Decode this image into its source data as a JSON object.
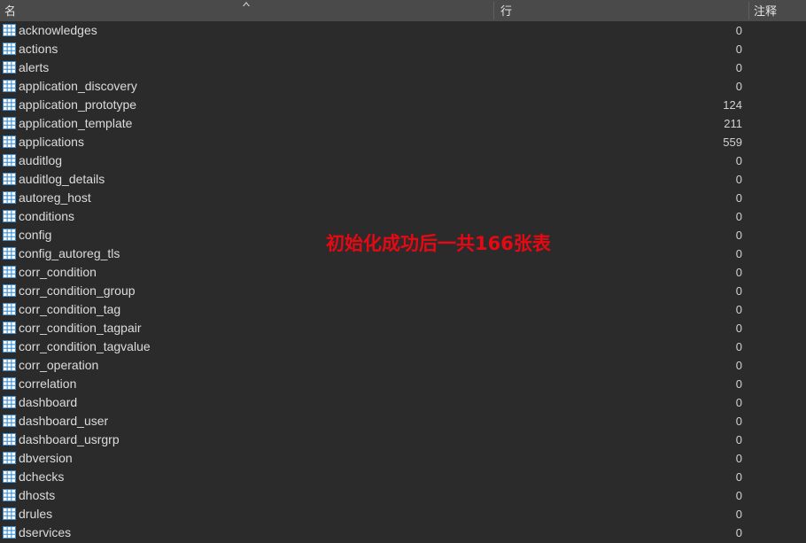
{
  "header": {
    "columns": [
      {
        "key": "name",
        "label": "名"
      },
      {
        "key": "rows",
        "label": "行"
      },
      {
        "key": "comment",
        "label": "注释"
      }
    ],
    "sort": {
      "column": "name",
      "direction": "ascending",
      "icon": "caret-up-icon"
    }
  },
  "annotation": {
    "text": "初始化成功后一共166张表",
    "color": "#e50914"
  },
  "colors": {
    "header_background": "#4a4a4a",
    "body_background": "#2b2b2b",
    "text": "#dcdcdc",
    "table_icon": "#3d8fd1",
    "annotation_red": "#e50914"
  },
  "table_list": {
    "row_icon": "table-icon",
    "rows": [
      {
        "name": "acknowledges",
        "rows": "0",
        "comment": ""
      },
      {
        "name": "actions",
        "rows": "0",
        "comment": ""
      },
      {
        "name": "alerts",
        "rows": "0",
        "comment": ""
      },
      {
        "name": "application_discovery",
        "rows": "0",
        "comment": ""
      },
      {
        "name": "application_prototype",
        "rows": "124",
        "comment": ""
      },
      {
        "name": "application_template",
        "rows": "211",
        "comment": ""
      },
      {
        "name": "applications",
        "rows": "559",
        "comment": ""
      },
      {
        "name": "auditlog",
        "rows": "0",
        "comment": ""
      },
      {
        "name": "auditlog_details",
        "rows": "0",
        "comment": ""
      },
      {
        "name": "autoreg_host",
        "rows": "0",
        "comment": ""
      },
      {
        "name": "conditions",
        "rows": "0",
        "comment": ""
      },
      {
        "name": "config",
        "rows": "0",
        "comment": ""
      },
      {
        "name": "config_autoreg_tls",
        "rows": "0",
        "comment": ""
      },
      {
        "name": "corr_condition",
        "rows": "0",
        "comment": ""
      },
      {
        "name": "corr_condition_group",
        "rows": "0",
        "comment": ""
      },
      {
        "name": "corr_condition_tag",
        "rows": "0",
        "comment": ""
      },
      {
        "name": "corr_condition_tagpair",
        "rows": "0",
        "comment": ""
      },
      {
        "name": "corr_condition_tagvalue",
        "rows": "0",
        "comment": ""
      },
      {
        "name": "corr_operation",
        "rows": "0",
        "comment": ""
      },
      {
        "name": "correlation",
        "rows": "0",
        "comment": ""
      },
      {
        "name": "dashboard",
        "rows": "0",
        "comment": ""
      },
      {
        "name": "dashboard_user",
        "rows": "0",
        "comment": ""
      },
      {
        "name": "dashboard_usrgrp",
        "rows": "0",
        "comment": ""
      },
      {
        "name": "dbversion",
        "rows": "0",
        "comment": ""
      },
      {
        "name": "dchecks",
        "rows": "0",
        "comment": ""
      },
      {
        "name": "dhosts",
        "rows": "0",
        "comment": ""
      },
      {
        "name": "drules",
        "rows": "0",
        "comment": ""
      },
      {
        "name": "dservices",
        "rows": "0",
        "comment": ""
      }
    ]
  }
}
